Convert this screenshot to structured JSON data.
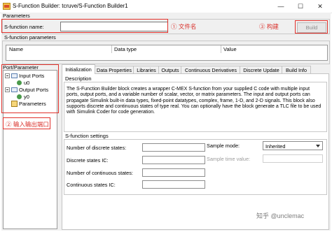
{
  "window": {
    "title": "S-Function Builder: tcruve/S-Function Builder1",
    "minimize": "—",
    "maximize": "☐",
    "close": "✕"
  },
  "parameters_group": {
    "label": "Parameters",
    "sfunction_name_label": "S-function name:",
    "sfunction_name_value": "",
    "build_label": "Build"
  },
  "annotations": {
    "filename": "① 文件名",
    "build": "③ 构建",
    "ports": "② 输入输出端口"
  },
  "sfunction_parameters": {
    "label": "S-function parameters",
    "columns": [
      "Name",
      "Data type",
      "Value"
    ]
  },
  "port_parameter": {
    "label": "Port/Parameter",
    "tree": [
      {
        "label": "Input Ports",
        "expanded": true
      },
      {
        "label": "u0"
      },
      {
        "label": "Output Ports",
        "expanded": true
      },
      {
        "label": "y0"
      },
      {
        "label": "Parameters"
      }
    ]
  },
  "tabs": [
    "Initialization",
    "Data Properties",
    "Libraries",
    "Outputs",
    "Continuous Derivatives",
    "Discrete Update",
    "Build Info"
  ],
  "active_tab": "Initialization",
  "description": {
    "label": "Description",
    "text": "The S-Function Builder block creates a wrapper C-MEX S-function from your supplied C code with multiple input ports, output ports, and a variable number of scalar, vector, or matrix parameters. The input and output ports can propagate Simulink built-in data types, fixed-point datatypes, complex, frame, 1-D, and 2-D signals. This block also supports discrete and continuous states of type real. You can optionally have the block generate a TLC file to be used with Simulink Coder for code generation."
  },
  "sfunction_settings": {
    "label": "S-function settings",
    "num_discrete_states_label": "Number of discrete states:",
    "num_discrete_states_value": "",
    "discrete_states_ic_label": "Discrete states IC:",
    "discrete_states_ic_value": "",
    "num_continuous_states_label": "Number of continuous states:",
    "num_continuous_states_value": "",
    "continuous_states_ic_label": "Continuous states IC:",
    "continuous_states_ic_value": "",
    "sample_mode_label": "Sample mode:",
    "sample_mode_value": "Inherited",
    "sample_time_label": "Sample time value:",
    "sample_time_value": ""
  },
  "watermark": "知乎 @unclemac",
  "colors": {
    "annotation_red": "#e1302a",
    "window_bg": "#f0f0f0"
  }
}
